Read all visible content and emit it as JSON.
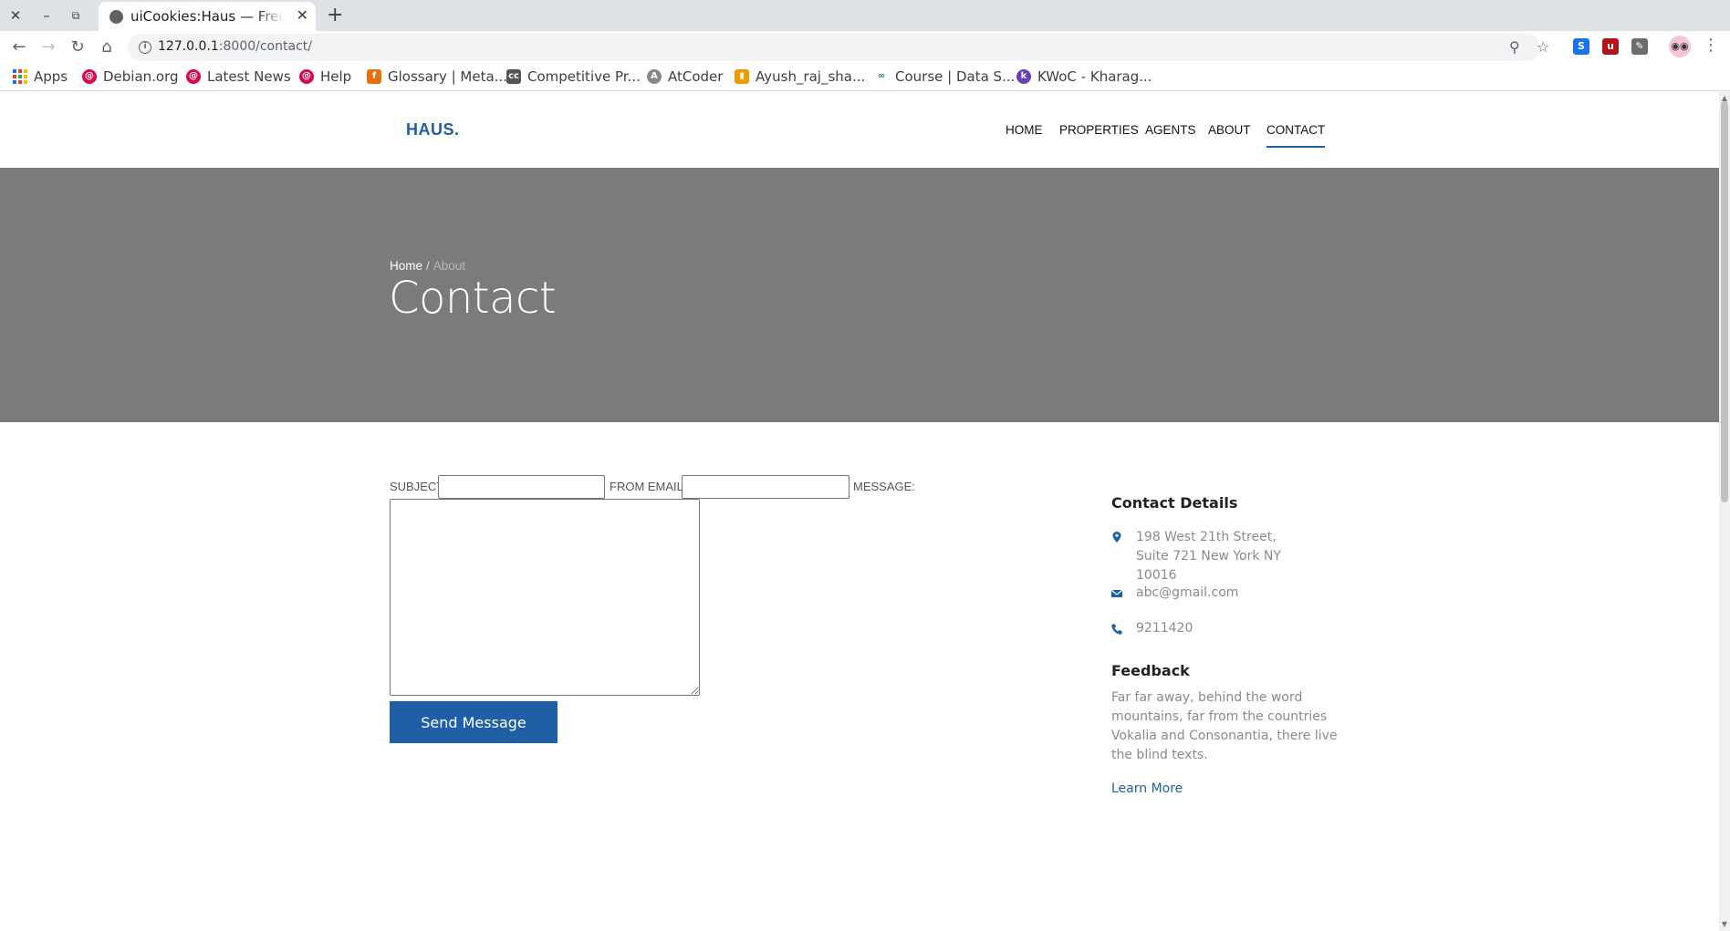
{
  "browser": {
    "tab_title": "uiCookies:Haus — Free Bootstrap Theme",
    "url_host": "127.0.0.1",
    "url_rest": ":8000/contact/",
    "bookmarks": [
      "Apps",
      "Debian.org",
      "Latest News",
      "Help",
      "Glossary | Meta...",
      "Competitive Pr...",
      "AtCoder",
      "Ayush_raj_sha...",
      "Course | Data S...",
      "KWoC - Kharag..."
    ]
  },
  "site": {
    "logo": "HAUS.",
    "nav": [
      "HOME",
      "PROPERTIES",
      "AGENTS",
      "ABOUT",
      "CONTACT"
    ],
    "active_nav": "CONTACT"
  },
  "hero": {
    "breadcrumb_home": "Home",
    "breadcrumb_sep": "/",
    "breadcrumb_current": "About",
    "title": "Contact"
  },
  "form": {
    "subject_label": "SUBJECT:",
    "subject_value": "",
    "email_label": "FROM EMAIL:",
    "email_value": "",
    "message_label": "MESSAGE:",
    "message_value": "",
    "submit_label": "Send Message"
  },
  "contact_details": {
    "heading": "Contact Details",
    "address": "198 West 21th Street, Suite 721 New York NY 10016",
    "email": "abc@gmail.com",
    "phone": "9211420"
  },
  "feedback": {
    "heading": "Feedback",
    "text": "Far far away, behind the word mountains, far from the countries Vokalia and Consonantia, there live the blind texts.",
    "link": "Learn More"
  },
  "colors": {
    "brand": "#1f5fa6",
    "hero_bg": "#7b7b7b"
  }
}
